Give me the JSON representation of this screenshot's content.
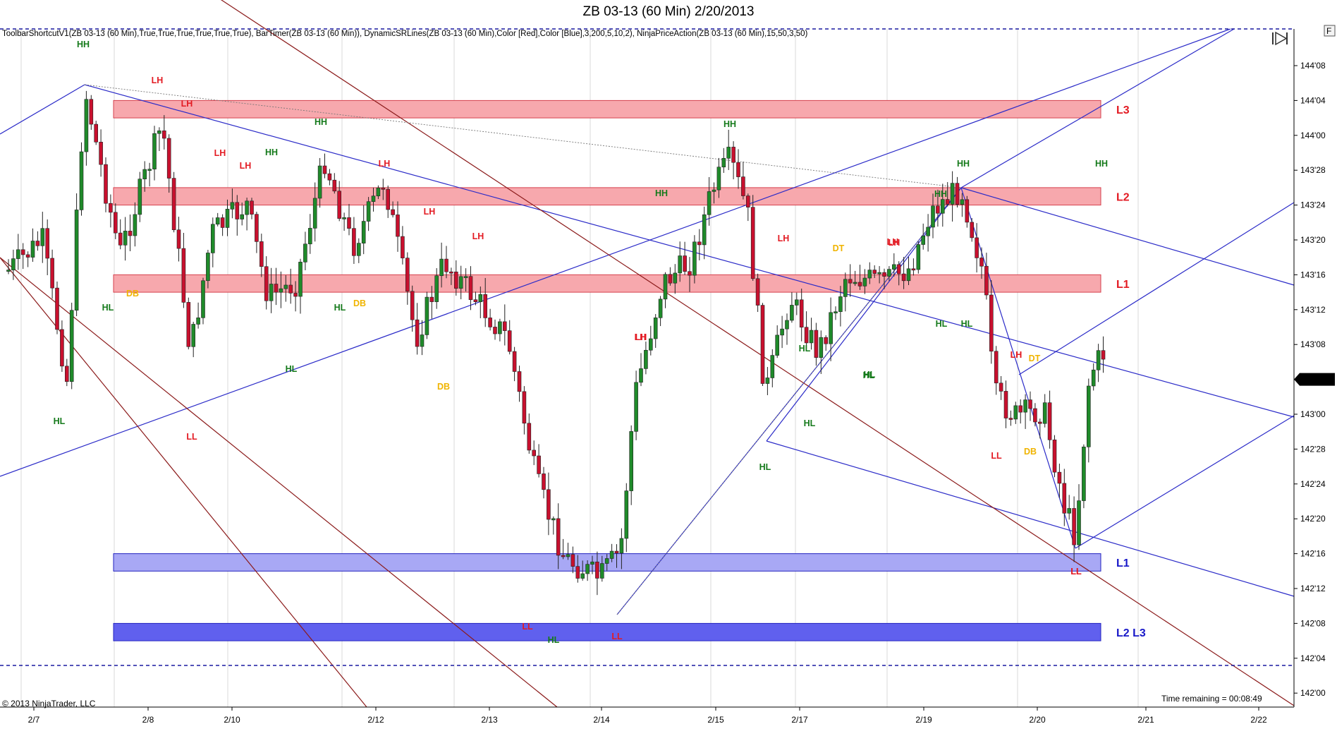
{
  "window": {
    "title": "ZB 03-13 (60 Min)  2/20/2013",
    "indicator_line": "ToolbarShortcutV1(ZB  03-13  (60  Min),True,True,True,True,True,True),  BarTimer(ZB  03-13  (60  Min)),  DynamicSRLines(ZB  03-13  (60  Min),Color  [Red],Color  [Blue],3,200,5,10,2),  NinjaPriceAction(ZB  03-13  (60  Min),15,50,3,50)",
    "copyright": "© 2013 NinjaTrader, LLC",
    "time_remaining": "Time remaining = 00:08:49",
    "corner_button": "F"
  },
  "colors": {
    "bull": "#1f8a2a",
    "bear": "#c8102e",
    "resistance_fill": "#f7a8ad",
    "resistance_stroke": "#d6414e",
    "support_fill_1": "#a8a8f5",
    "support_fill_2": "#6060ee",
    "channel_blue": "#2b2bc8",
    "channel_red": "#8b1a1a",
    "label_red": "#e31b23",
    "label_green": "#157a1b",
    "label_yellow": "#f0b400",
    "label_blue": "#1818c8"
  },
  "chart_data": {
    "type": "candlestick",
    "title": "ZB 03-13 (60 Min)  2/20/2013",
    "price_axis_ticks": [
      "144'08",
      "144'04",
      "144'00",
      "143'28",
      "143'24",
      "143'20",
      "143'16",
      "143'12",
      "143'08",
      "143'04",
      "143'00",
      "142'28",
      "142'24",
      "142'20",
      "142'16",
      "142'12",
      "142'08",
      "142'04",
      "142'00"
    ],
    "date_axis_ticks": [
      "2/7",
      "2/8",
      "2/10",
      "2/12",
      "2/13",
      "2/14",
      "2/15",
      "2/17",
      "2/19",
      "2/20",
      "2/21",
      "2/22"
    ],
    "last_price": "143'04",
    "y_range_32nds": [
      4607,
      4620
    ],
    "zones": [
      {
        "label": "L3",
        "kind": "resistance",
        "y": 144.125,
        "height": 0.0625
      },
      {
        "label": "L2",
        "kind": "resistance",
        "y": 143.8125,
        "height": 0.0625
      },
      {
        "label": "L1",
        "kind": "resistance",
        "y": 143.5,
        "height": 0.0625
      },
      {
        "label": "L1",
        "kind": "support",
        "y": 142.5,
        "height": 0.0625
      },
      {
        "label": "L2 L3",
        "kind": "support",
        "y": 142.25,
        "height": 0.0625
      }
    ],
    "swing_labels": [
      {
        "text": "HH",
        "color": "green"
      },
      {
        "text": "LH",
        "color": "red"
      },
      {
        "text": "LH",
        "color": "red"
      },
      {
        "text": "LH",
        "color": "red"
      },
      {
        "text": "HH",
        "color": "green"
      },
      {
        "text": "LH",
        "color": "red"
      },
      {
        "text": "HH",
        "color": "green"
      },
      {
        "text": "LH",
        "color": "red"
      },
      {
        "text": "LH",
        "color": "red"
      },
      {
        "text": "HH",
        "color": "green"
      },
      {
        "text": "HH",
        "color": "green"
      },
      {
        "text": "HH",
        "color": "green"
      },
      {
        "text": "LH",
        "color": "red"
      },
      {
        "text": "LH",
        "color": "red"
      },
      {
        "text": "LH",
        "color": "red"
      },
      {
        "text": "LH",
        "color": "red"
      },
      {
        "text": "HH",
        "color": "green"
      },
      {
        "text": "HH",
        "color": "green"
      },
      {
        "text": "LH",
        "color": "red"
      },
      {
        "text": "DT",
        "color": "yellow"
      },
      {
        "text": "LH",
        "color": "red"
      },
      {
        "text": "HL",
        "color": "green"
      },
      {
        "text": "DB",
        "color": "yellow"
      },
      {
        "text": "HL",
        "color": "green"
      },
      {
        "text": "DB",
        "color": "yellow"
      },
      {
        "text": "HL",
        "color": "green"
      },
      {
        "text": "HL",
        "color": "green"
      },
      {
        "text": "HL",
        "color": "green"
      },
      {
        "text": "LH",
        "color": "red"
      },
      {
        "text": "HL",
        "color": "green"
      },
      {
        "text": "LL",
        "color": "red"
      },
      {
        "text": "DB",
        "color": "yellow"
      },
      {
        "text": "HL",
        "color": "green"
      },
      {
        "text": "LH",
        "color": "red"
      },
      {
        "text": "DT",
        "color": "yellow"
      },
      {
        "text": "HL",
        "color": "green"
      },
      {
        "text": "LL",
        "color": "red"
      },
      {
        "text": "DB",
        "color": "yellow"
      },
      {
        "text": "LL",
        "color": "red"
      },
      {
        "text": "HL",
        "color": "green"
      },
      {
        "text": "HL",
        "color": "green"
      },
      {
        "text": "HL",
        "color": "green"
      },
      {
        "text": "HL",
        "color": "green"
      },
      {
        "text": "LL",
        "color": "red"
      },
      {
        "text": "LL",
        "color": "red"
      },
      {
        "text": "LL",
        "color": "red"
      }
    ]
  }
}
